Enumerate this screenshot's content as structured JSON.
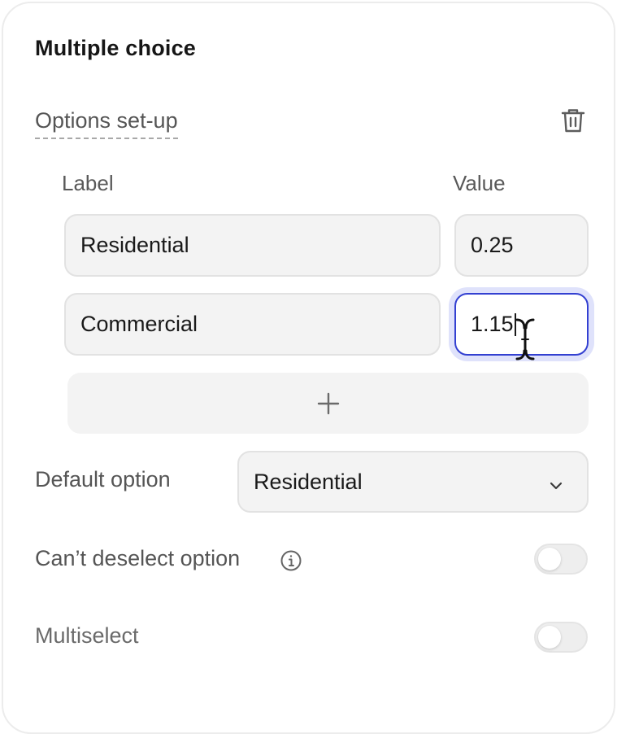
{
  "panel": {
    "title": "Multiple choice",
    "section_label": "Options set-up"
  },
  "options_table": {
    "label_header": "Label",
    "value_header": "Value",
    "rows": [
      {
        "label": "Residential",
        "value": "0.25"
      },
      {
        "label": "Commercial",
        "value": "1.15"
      }
    ],
    "add_symbol": "+"
  },
  "default_option": {
    "label": "Default option",
    "selected": "Residential"
  },
  "settings": {
    "cant_deselect": {
      "label": "Can’t deselect option",
      "enabled": false
    },
    "multiselect": {
      "label": "Multiselect",
      "enabled": false
    }
  },
  "icons": {
    "delete": "trash-icon",
    "expand": "chevron-down-icon",
    "info": "info-icon",
    "add": "plus-icon",
    "text_cursor": "i-beam-cursor-icon"
  },
  "colors": {
    "focus_border": "#3340d1",
    "focus_ring": "#dfe2fb",
    "field_bg": "#f3f3f3"
  }
}
